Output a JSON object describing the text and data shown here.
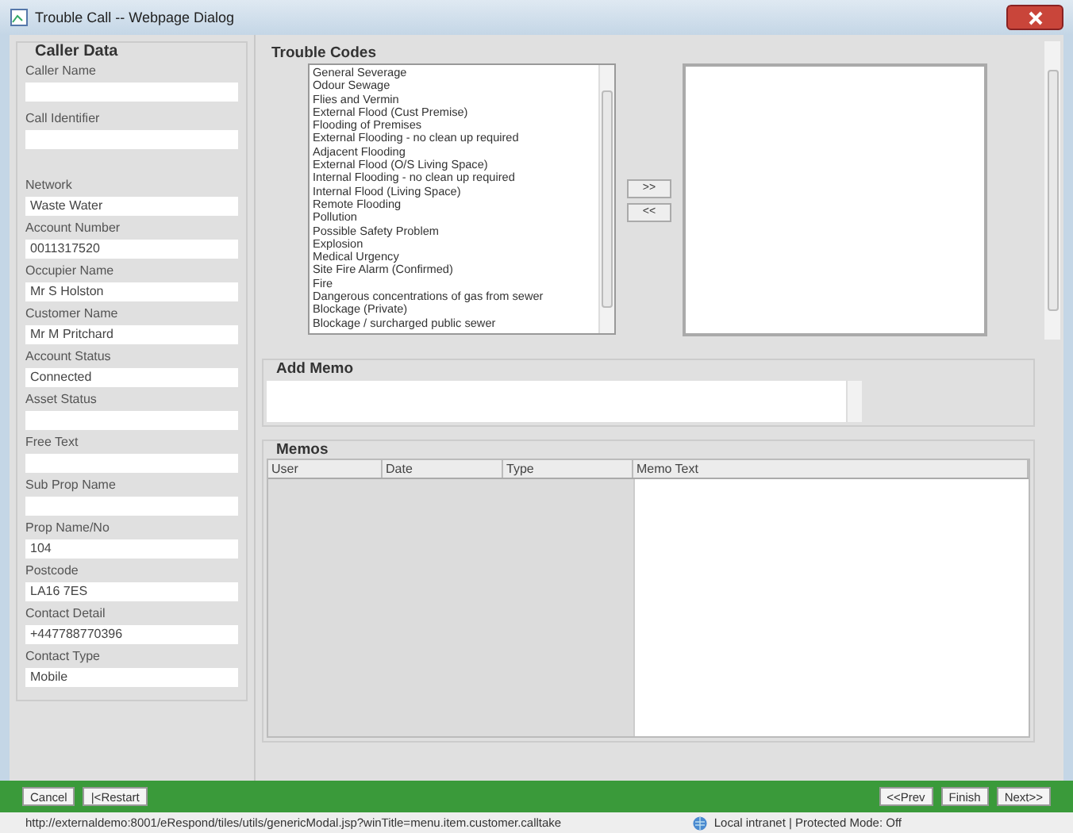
{
  "window": {
    "title": "Trouble Call -- Webpage Dialog"
  },
  "caller_data": {
    "title": "Caller Data",
    "caller_fields": [
      {
        "label": "Caller Name"
      },
      {
        "label": "Call Identifier"
      }
    ],
    "account_fields": [
      {
        "label": "Network",
        "value": "Waste Water"
      },
      {
        "label": "Account Number",
        "value": "0011317520"
      },
      {
        "label": "Occupier Name",
        "value": "Mr S Holston"
      },
      {
        "label": "Customer Name",
        "value": "Mr M Pritchard"
      },
      {
        "label": "Account Status",
        "value": "Connected"
      },
      {
        "label": "Asset Status"
      },
      {
        "label": "Free Text"
      },
      {
        "label": "Sub Prop Name"
      },
      {
        "label": "Prop Name/No",
        "value": "104"
      },
      {
        "label": "Postcode",
        "value": "LA16 7ES"
      },
      {
        "label": "Contact Detail",
        "value": "+447788770396"
      },
      {
        "label": "Contact Type",
        "value": "Mobile"
      }
    ]
  },
  "trouble_codes": {
    "title": "Trouble Codes",
    "available": [
      "General Severage",
      "Odour Sewage",
      "Flies and Vermin",
      "External Flood (Cust Premise)",
      "Flooding of Premises",
      "External Flooding - no clean up required",
      "Adjacent Flooding",
      "External Flood (O/S Living Space)",
      "Internal Flooding - no clean up required",
      "Internal Flood (Living Space)",
      "Remote Flooding",
      "Pollution",
      "Possible Safety Problem",
      "Explosion",
      "Medical Urgency",
      "Site Fire Alarm (Confirmed)",
      "Fire",
      "Dangerous concentrations of gas from sewer",
      "Blockage (Private)",
      "Blockage / surcharged public sewer"
    ],
    "add_button": ">>",
    "remove_button": "<<"
  },
  "add_memo": {
    "title": "Add Memo"
  },
  "memos": {
    "title": "Memos",
    "columns": [
      "User",
      "Date",
      "Type",
      "Memo Text"
    ]
  },
  "footer": {
    "left_buttons": [
      "Cancel",
      "|<Restart"
    ],
    "right_buttons": [
      "<<Prev",
      "Finish",
      "Next>>"
    ]
  },
  "status_bar": {
    "url": "http://externaldemo:8001/eRespond/tiles/utils/genericModal.jsp?winTitle=menu.item.customer.calltake",
    "zone": "Local intranet | Protected Mode: Off"
  }
}
